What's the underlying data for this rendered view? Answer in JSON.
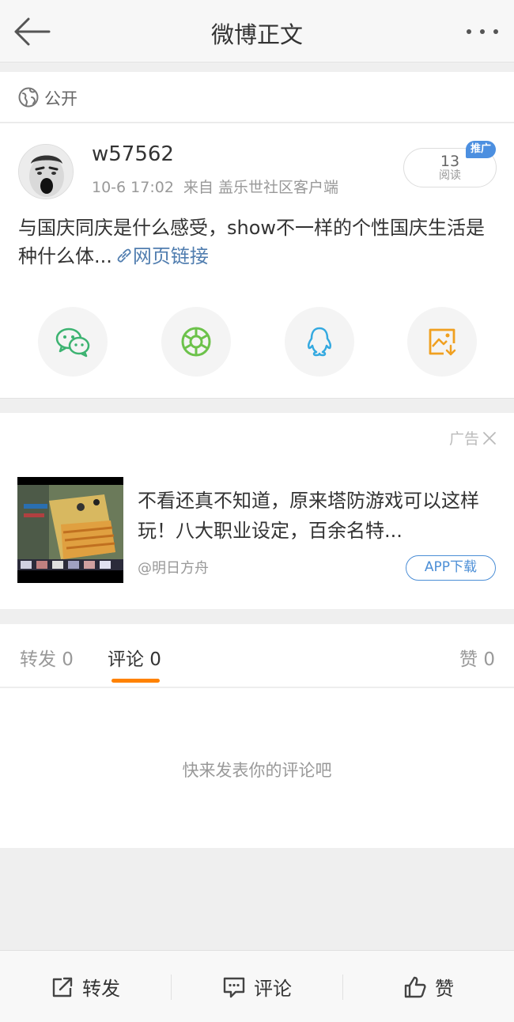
{
  "header": {
    "title": "微博正文"
  },
  "visibility": {
    "label": "公开"
  },
  "post": {
    "username": "w57562",
    "time": "10-6 17:02",
    "source": "来自 盖乐世社区客户端",
    "read_count": "13",
    "read_label": "阅读",
    "promo_badge": "推广",
    "text": "与国庆同庆是什么感受，show不一样的个性国庆生活是种什么体...",
    "link_text": "网页链接"
  },
  "share": {
    "items": [
      {
        "name": "wechat-icon",
        "color": "#3cb371"
      },
      {
        "name": "moments-icon",
        "color": "#6cc24a"
      },
      {
        "name": "qq-icon",
        "color": "#34a9e0"
      },
      {
        "name": "save-image-icon",
        "color": "#f0a020"
      }
    ]
  },
  "ad": {
    "tag": "广告",
    "title": "不看还真不知道，原来塔防游戏可以这样玩！八大职业设定，百余名特...",
    "source": "@明日方舟",
    "cta": "APP下载"
  },
  "tabs": {
    "repost": "转发 0",
    "comment": "评论 0",
    "like": "赞 0"
  },
  "comments": {
    "empty_text": "快来发表你的评论吧"
  },
  "bottom_bar": {
    "repost": "转发",
    "comment": "评论",
    "like": "赞"
  },
  "colors": {
    "accent": "#ff8200",
    "link": "#507daf",
    "cta": "#4b8ed6",
    "badge": "#4c8fe0"
  }
}
